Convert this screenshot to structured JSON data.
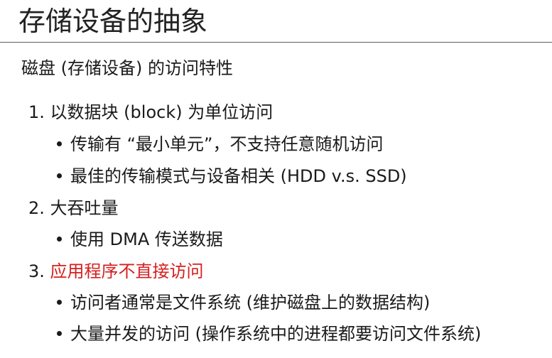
{
  "title": "存储设备的抽象",
  "intro": "磁盘 (存储设备) 的访问特性",
  "accent_color": "#d42020",
  "items": [
    {
      "num": "1.",
      "text": "以数据块 (block) 为单位访问",
      "highlight": false,
      "bullets": [
        "传输有 “最小单元”，不支持任意随机访问",
        "最佳的传输模式与设备相关 (HDD v.s. SSD)"
      ]
    },
    {
      "num": "2.",
      "text": "大吞吐量",
      "highlight": false,
      "bullets": [
        "使用 DMA 传送数据"
      ]
    },
    {
      "num": "3.",
      "text": "应用程序不直接访问",
      "highlight": true,
      "bullets": [
        "访问者通常是文件系统 (维护磁盘上的数据结构)",
        "大量并发的访问 (操作系统中的进程都要访问文件系统)"
      ]
    }
  ]
}
